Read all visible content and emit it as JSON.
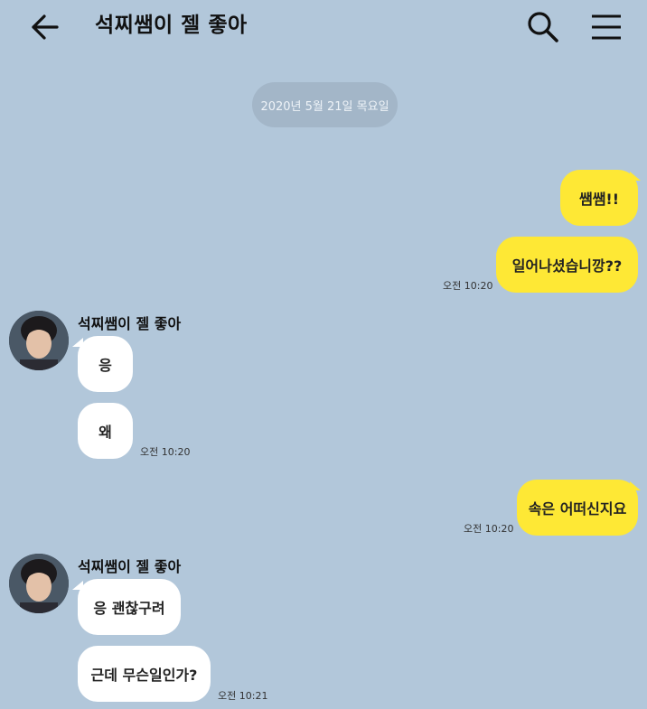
{
  "header": {
    "title": "석찌쌤이 젤 좋아",
    "back_icon": "arrow-left-icon",
    "search_icon": "search-icon",
    "menu_icon": "hamburger-menu-icon"
  },
  "date_divider": "2020년 5월 21일 목요일",
  "colors": {
    "background": "#b2c7da",
    "my_bubble": "#fee835",
    "their_bubble": "#ffffff",
    "date_pill": "#a3b6c8"
  },
  "messages": [
    {
      "from": "me",
      "text": "쌤쌤!!"
    },
    {
      "from": "me",
      "text": "일어나셨습니깡??",
      "time": "오전 10:20"
    },
    {
      "from": "them",
      "sender": "석찌쌤이 젤 좋아",
      "text": "응"
    },
    {
      "from": "them",
      "text": "왜",
      "time": "오전 10:20"
    },
    {
      "from": "me",
      "text": "속은 어떠신지요",
      "time": "오전 10:20"
    },
    {
      "from": "them",
      "sender": "석찌쌤이 젤 좋아",
      "text": "응 괜찮구려"
    },
    {
      "from": "them",
      "text": "근데 무슨일인가?",
      "time": "오전 10:21"
    }
  ]
}
